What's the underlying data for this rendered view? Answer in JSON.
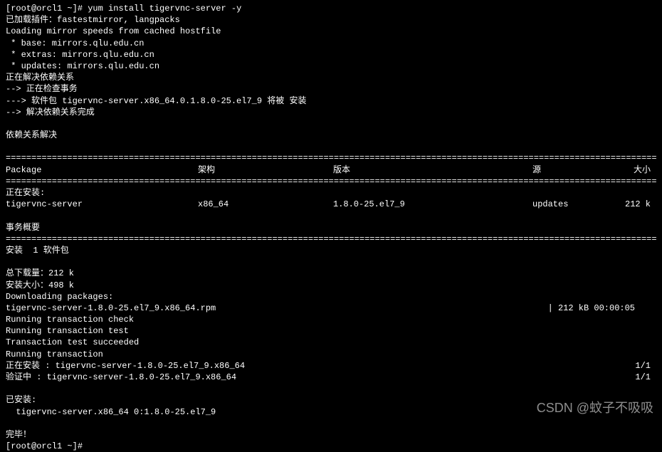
{
  "prompt": {
    "user_host": "[root@orcl1 ~]#",
    "command": "yum install tigervnc-server -y"
  },
  "preamble": [
    "已加载插件：fastestmirror, langpacks",
    "Loading mirror speeds from cached hostfile",
    " * base: mirrors.qlu.edu.cn",
    " * extras: mirrors.qlu.edu.cn",
    " * updates: mirrors.qlu.edu.cn",
    "正在解决依赖关系",
    "--> 正在检查事务",
    "---> 软件包 tigervnc-server.x86_64.0.1.8.0-25.el7_9 将被 安装",
    "--> 解决依赖关系完成"
  ],
  "dep_resolved": "依赖关系解决",
  "table": {
    "headers": {
      "package": " Package",
      "arch": "架构",
      "version": "版本",
      "repo": "源",
      "size": "大小"
    },
    "install_header": "正在安装:",
    "rows": [
      {
        "package": " tigervnc-server",
        "arch": "x86_64",
        "version": "1.8.0-25.el7_9",
        "repo": "updates",
        "size": "212 k"
      }
    ]
  },
  "summary_header": "事务概要",
  "summary_line": "安装  1 软件包",
  "download": {
    "total_download": "总下载量：212 k",
    "install_size": "安装大小：498 k",
    "downloading": "Downloading packages:",
    "file": "tigervnc-server-1.8.0-25.el7_9.x86_64.rpm",
    "stats": "| 212 kB  00:00:05"
  },
  "transaction": [
    "Running transaction check",
    "Running transaction test",
    "Transaction test succeeded",
    "Running transaction"
  ],
  "install_steps": [
    {
      "label": "  正在安装    : tigervnc-server-1.8.0-25.el7_9.x86_64",
      "count": "1/1"
    },
    {
      "label": "  验证中      : tigervnc-server-1.8.0-25.el7_9.x86_64",
      "count": "1/1"
    }
  ],
  "installed": {
    "header": "已安装:",
    "item": "  tigervnc-server.x86_64 0:1.8.0-25.el7_9"
  },
  "done": "完毕！",
  "final_prompt": "[root@orcl1 ~]#",
  "watermark": "CSDN @蚊子不吸吸",
  "divider_char": "="
}
